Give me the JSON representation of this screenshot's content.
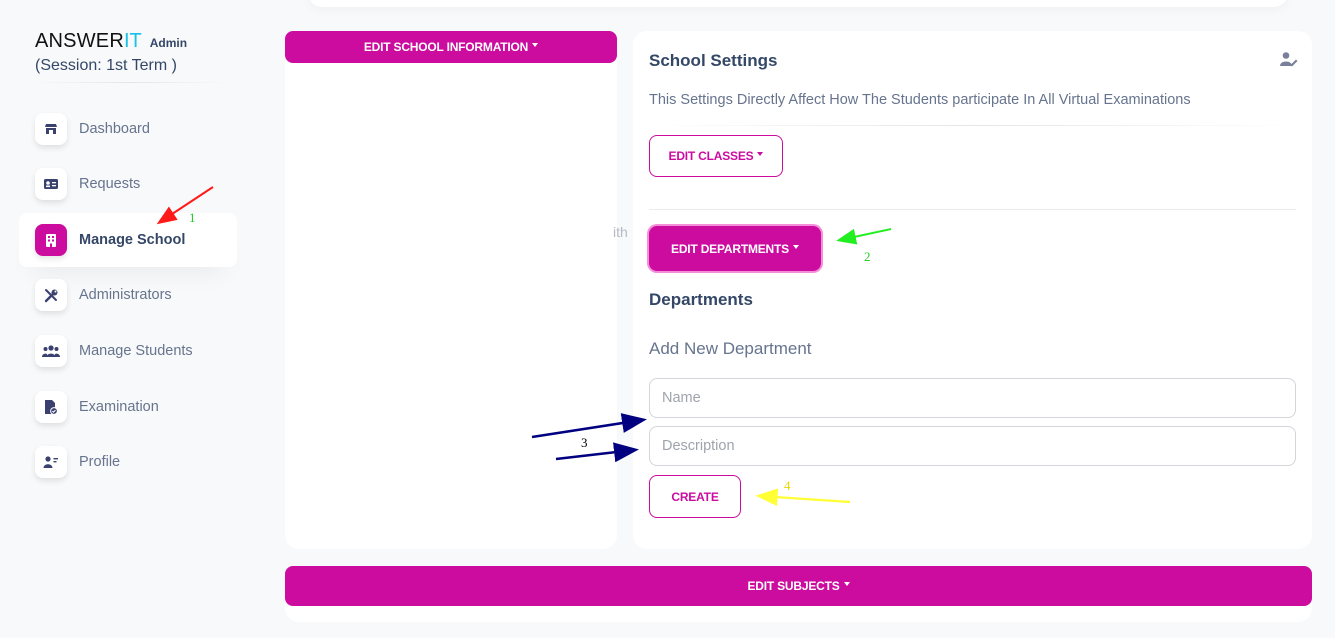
{
  "brand": {
    "name": "ANSWER",
    "name_accent": "IT",
    "role": "Admin",
    "session": "(Session: 1st Term )"
  },
  "sidebar": {
    "items": [
      {
        "label": "Dashboard",
        "icon": "store-icon",
        "active": false
      },
      {
        "label": "Requests",
        "icon": "id-card-icon",
        "active": false
      },
      {
        "label": "Manage School",
        "icon": "building-icon",
        "active": true
      },
      {
        "label": "Administrators",
        "icon": "tools-icon",
        "active": false
      },
      {
        "label": "Manage Students",
        "icon": "users-icon",
        "active": false
      },
      {
        "label": "Examination",
        "icon": "file-check-icon",
        "active": false
      },
      {
        "label": "Profile",
        "icon": "user-icon",
        "active": false
      }
    ]
  },
  "left_card": {
    "edit_school_info_label": "EDIT SCHOOL INFORMATION",
    "ghost_text": "ith"
  },
  "settings": {
    "title": "School Settings",
    "subtitle": "This Settings Directly Affect How The Students participate In All Virtual Examinations",
    "edit_classes_label": "EDIT CLASSES",
    "edit_departments_label": "EDIT DEPARTMENTS"
  },
  "departments": {
    "title": "Departments",
    "subtitle": "Add New Department",
    "name_placeholder": "Name",
    "description_placeholder": "Description",
    "create_label": "CREATE"
  },
  "bottom": {
    "edit_subjects_label": "EDIT SUBJECTS"
  },
  "annotations": {
    "labels": [
      "1",
      "2",
      "3",
      "4"
    ],
    "colors": [
      "#ff1a1a",
      "#22ee22",
      "#000080",
      "#ffff33"
    ]
  },
  "colors": {
    "accent": "#cb0c9f",
    "brand_accent": "#17c1e8",
    "text_dark": "#344767",
    "text_muted": "#67748e"
  }
}
